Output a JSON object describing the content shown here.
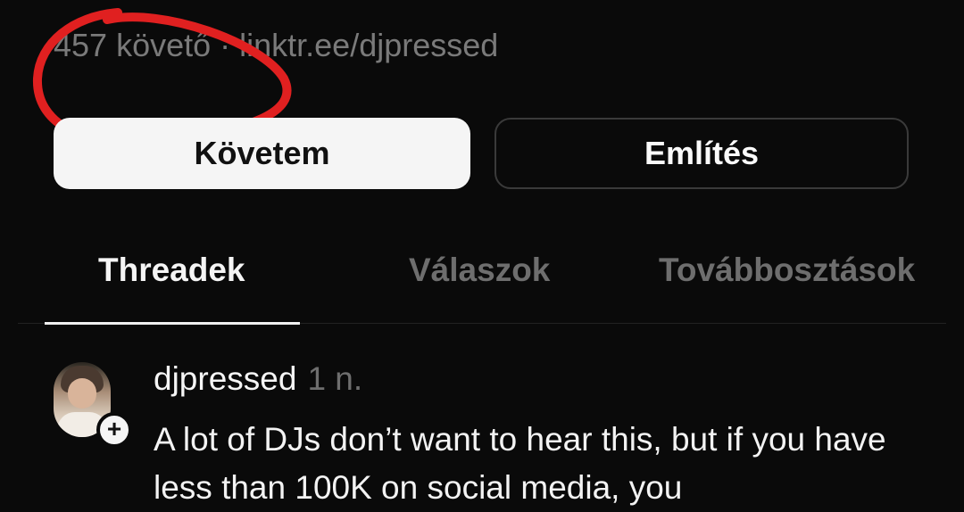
{
  "profile": {
    "followers_text": "457 követő",
    "link": "linktr.ee/djpressed"
  },
  "buttons": {
    "follow_label": "Követem",
    "mention_label": "Említés"
  },
  "tabs": [
    {
      "label": "Threadek",
      "active": true
    },
    {
      "label": "Válaszok",
      "active": false
    },
    {
      "label": "Továbbosztások",
      "active": false
    }
  ],
  "post": {
    "username": "djpressed",
    "time": "1 n.",
    "text": "A lot of DJs don’t want to hear this, but if you have less than 100K on social media, you"
  },
  "colors": {
    "background": "#0a0a0a",
    "annotation_circle": "#e02020"
  }
}
